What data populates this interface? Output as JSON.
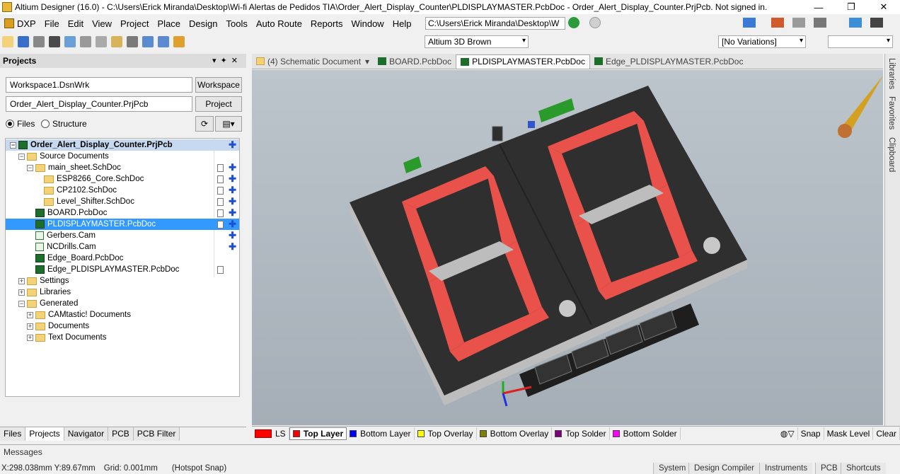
{
  "window": {
    "title": "Altium Designer (16.0) - C:\\Users\\Erick Miranda\\Desktop\\Wi-fi Alertas de Pedidos TIA\\Order_Alert_Display_Counter\\PLDISPLAYMASTER.PcbDoc - Order_Alert_Display_Counter.PrjPcb. Not signed in.",
    "minimize": "—",
    "maximize": "❐",
    "close": "✕"
  },
  "menu": {
    "items": [
      "DXP",
      "File",
      "Edit",
      "View",
      "Project",
      "Place",
      "Design",
      "Tools",
      "Auto Route",
      "Reports",
      "Window",
      "Help"
    ],
    "address": "C:\\Users\\Erick Miranda\\Desktop\\W"
  },
  "toolbar": {
    "view_config": "Altium 3D Brown",
    "variations": "[No Variations]"
  },
  "projects_panel": {
    "title": "Projects",
    "workspace_field": "Workspace1.DsnWrk",
    "workspace_button": "Workspace",
    "project_field": "Order_Alert_Display_Counter.PrjPcb",
    "project_button": "Project",
    "radio_files": "Files",
    "radio_structure": "Structure",
    "tree": [
      {
        "label": "Order_Alert_Display_Counter.PrjPcb",
        "kind": "project"
      },
      {
        "label": "Source Documents",
        "kind": "folder"
      },
      {
        "label": "main_sheet.SchDoc",
        "kind": "folder"
      },
      {
        "label": "ESP8266_Core.SchDoc",
        "kind": "sch"
      },
      {
        "label": "CP2102.SchDoc",
        "kind": "sch"
      },
      {
        "label": "Level_Shifter.SchDoc",
        "kind": "sch"
      },
      {
        "label": "BOARD.PcbDoc",
        "kind": "pcb"
      },
      {
        "label": "PLDISPLAYMASTER.PcbDoc",
        "kind": "pcb"
      },
      {
        "label": "Gerbers.Cam",
        "kind": "cam"
      },
      {
        "label": "NCDrills.Cam",
        "kind": "cam"
      },
      {
        "label": "Edge_Board.PcbDoc",
        "kind": "pcb"
      },
      {
        "label": "Edge_PLDISPLAYMASTER.PcbDoc",
        "kind": "pcb"
      },
      {
        "label": "Settings",
        "kind": "folder"
      },
      {
        "label": "Libraries",
        "kind": "folder"
      },
      {
        "label": "Generated",
        "kind": "folder"
      },
      {
        "label": "CAMtastic! Documents",
        "kind": "folder"
      },
      {
        "label": "Documents",
        "kind": "folder"
      },
      {
        "label": "Text Documents",
        "kind": "folder"
      }
    ],
    "bottom_tabs": [
      "Files",
      "Projects",
      "Navigator",
      "PCB",
      "PCB Filter"
    ]
  },
  "doc_tabs": [
    "(4) Schematic Document",
    "BOARD.PcbDoc",
    "PLDISPLAYMASTER.PcbDoc",
    "Edge_PLDISPLAYMASTER.PcbDoc"
  ],
  "right_tabs": [
    "Libraries",
    "Favorites",
    "Clipboard"
  ],
  "layers": {
    "current": "LS",
    "items": [
      {
        "label": "Top Layer",
        "color": "#ff0000"
      },
      {
        "label": "Bottom Layer",
        "color": "#0000ff"
      },
      {
        "label": "Top Overlay",
        "color": "#ffff00"
      },
      {
        "label": "Bottom Overlay",
        "color": "#808000"
      },
      {
        "label": "Top Solder",
        "color": "#800080"
      },
      {
        "label": "Bottom Solder",
        "color": "#ff00ff"
      }
    ],
    "snap": "Snap",
    "mask_level": "Mask Level",
    "clear": "Clear"
  },
  "messages_tab": "Messages",
  "status": {
    "coords": "X:298.038mm Y:89.67mm",
    "grid": "Grid: 0.001mm",
    "snap": "(Hotspot Snap)",
    "buttons": [
      "System",
      "Design Compiler",
      "Instruments",
      "PCB",
      "Shortcuts"
    ]
  }
}
